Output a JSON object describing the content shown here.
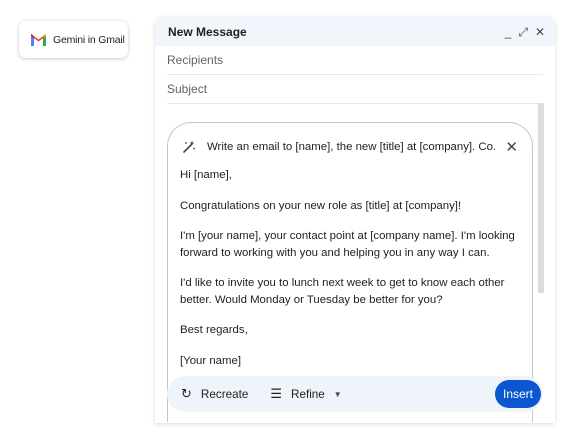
{
  "brand": {
    "name": "Gemini in Gmail",
    "logo_icon": "gmail-logo-icon",
    "colors": {
      "red": "#ea4335",
      "blue": "#4285f4",
      "green": "#34a853",
      "yellow": "#fbbc04"
    }
  },
  "compose": {
    "title": "New Message",
    "controls": {
      "minimize": "_",
      "popout": "⤢",
      "close": "✕"
    },
    "recipients_placeholder": "Recipients",
    "subject_placeholder": "Subject"
  },
  "gemini": {
    "prompt_icon": "magic-wand-icon",
    "prompt": "Write an email to [name], the new [title] at [company]. Co...",
    "close": "✕",
    "draft": {
      "greeting": "Hi [name],",
      "p1": "Congratulations on your new role as [title] at [company]!",
      "p2": "I'm [your name], your contact point at [company name]. I'm looking forward to working with you and helping you in any way I can.",
      "p3": "I'd like to invite you to lunch next week to get to know each other better. Would Monday or Tuesday be better for you?",
      "closing": "Best regards,",
      "signature": "[Your name]"
    }
  },
  "actions": {
    "recreate": {
      "label": "Recreate",
      "icon": "refresh-icon",
      "glyph": "↻"
    },
    "refine": {
      "label": "Refine",
      "icon": "filter-lines-icon",
      "glyph": "☰",
      "caret": "▼"
    },
    "insert": "Insert",
    "accent": "#0b57d0",
    "bar_background": "#eff3fa"
  }
}
